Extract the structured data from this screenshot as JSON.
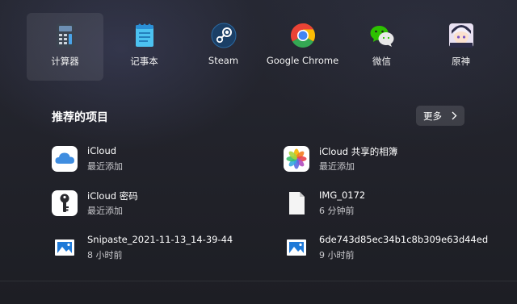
{
  "pinned": [
    {
      "label": "计算器",
      "icon": "calculator-icon"
    },
    {
      "label": "记事本",
      "icon": "notepad-icon"
    },
    {
      "label": "Steam",
      "icon": "steam-icon"
    },
    {
      "label": "Google Chrome",
      "icon": "chrome-icon"
    },
    {
      "label": "微信",
      "icon": "wechat-icon"
    },
    {
      "label": "原神",
      "icon": "genshin-icon"
    }
  ],
  "recommended": {
    "title": "推荐的项目",
    "more_label": "更多",
    "items": [
      {
        "name": "iCloud",
        "sub": "最近添加",
        "icon": "icloud-icon"
      },
      {
        "name": "iCloud 共享的相簿",
        "sub": "最近添加",
        "icon": "photos-icon"
      },
      {
        "name": "iCloud 密码",
        "sub": "最近添加",
        "icon": "key-icon"
      },
      {
        "name": "IMG_0172",
        "sub": "6 分钟前",
        "icon": "file-icon"
      },
      {
        "name": "Snipaste_2021-11-13_14-39-44",
        "sub": "8 小时前",
        "icon": "image-icon"
      },
      {
        "name": "6de743d85ec34b1c8b309e63d44ed...",
        "sub": "9 小时前",
        "icon": "image-icon"
      }
    ]
  }
}
